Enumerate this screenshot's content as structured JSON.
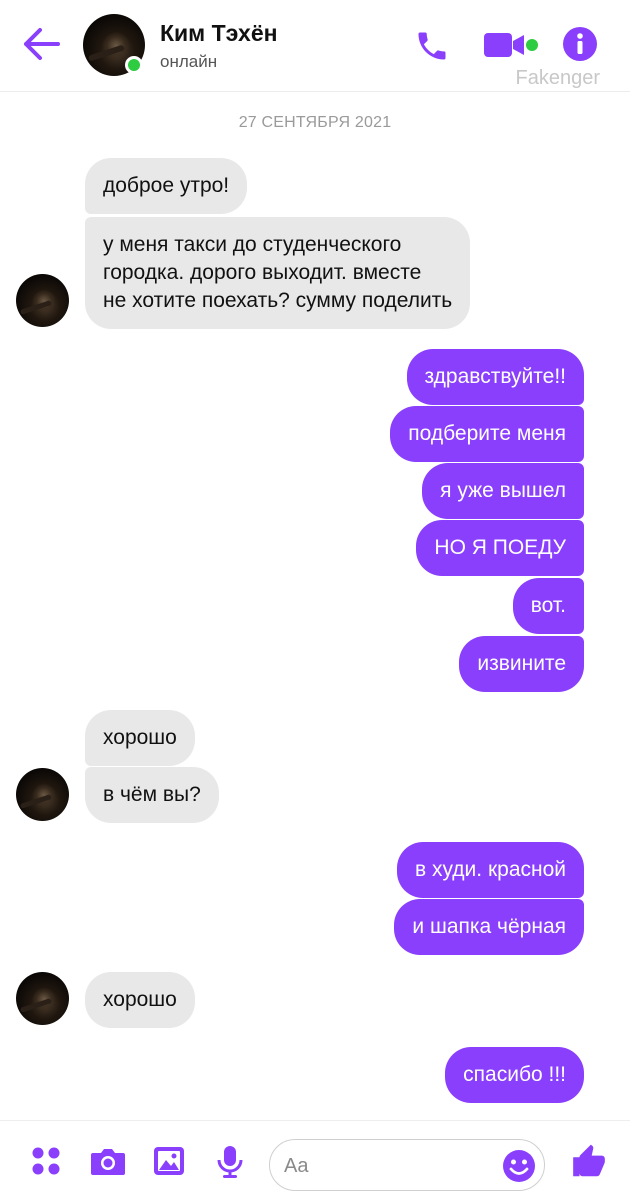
{
  "header": {
    "contact_name": "Ким Тэхён",
    "status": "онлайн",
    "brand": "Fakenger",
    "icons": [
      "arrow-left-icon",
      "phone-icon",
      "video-camera-icon",
      "info-icon"
    ],
    "accent_color": "#8a3ffc",
    "online_color": "#2ecc40"
  },
  "chat": {
    "date": "27 СЕНТЯБРЯ 2021",
    "messages": [
      {
        "side": "in",
        "text": "доброе утро!"
      },
      {
        "side": "in",
        "lines": [
          "у меня такси до студенческого",
          "городка. дорого выходит. вместе",
          "не хотите поехать? сумму поделить"
        ]
      },
      {
        "side": "out",
        "text": "здравствуйте!!"
      },
      {
        "side": "out",
        "text": "подберите меня"
      },
      {
        "side": "out",
        "text": "я уже вышел"
      },
      {
        "side": "out",
        "text": "НО Я ПОЕДУ"
      },
      {
        "side": "out",
        "text": "вот."
      },
      {
        "side": "out",
        "text": "извините"
      },
      {
        "side": "in",
        "text": "хорошо"
      },
      {
        "side": "in",
        "text": "в чём вы?"
      },
      {
        "side": "out",
        "text": "в худи. красной"
      },
      {
        "side": "out",
        "text": "и шапка чёрная"
      },
      {
        "side": "in",
        "text": "хорошо"
      },
      {
        "side": "out",
        "text": "спасибо !!!"
      }
    ]
  },
  "composer": {
    "placeholder": "Aa",
    "icons": [
      "apps-dots-icon",
      "camera-icon",
      "image-icon",
      "microphone-icon",
      "emoji-icon",
      "thumbs-up-icon"
    ]
  }
}
